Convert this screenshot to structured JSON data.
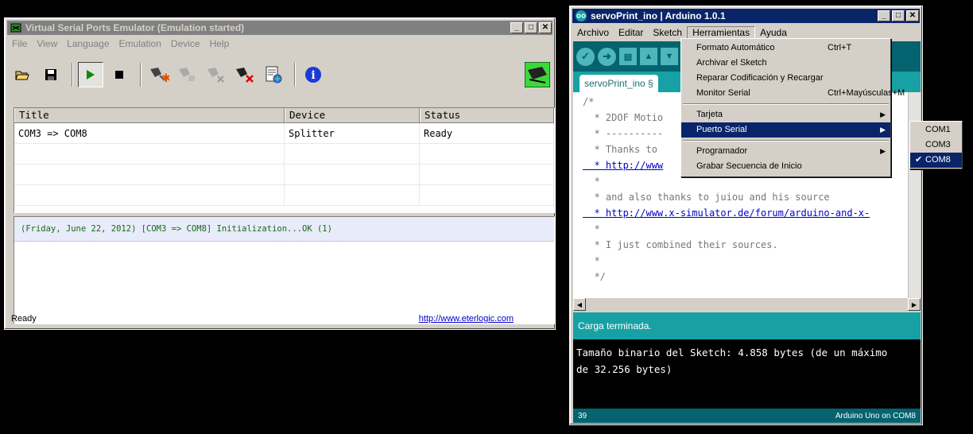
{
  "vspe": {
    "title": "Virtual Serial Ports Emulator (Emulation started)",
    "menu": [
      "File",
      "View",
      "Language",
      "Emulation",
      "Device",
      "Help"
    ],
    "table": {
      "headers": [
        "Title",
        "Device",
        "Status"
      ],
      "rows": [
        [
          "COM3 => COM8",
          "Splitter",
          "Ready"
        ]
      ]
    },
    "log": [
      "(Friday, June 22, 2012) [COM3 => COM8] Initialization...OK (1)"
    ],
    "status_text": "Ready",
    "status_link": "http://www.eterlogic.com"
  },
  "arduino": {
    "title": "servoPrint_ino | Arduino 1.0.1",
    "menu": [
      "Archivo",
      "Editar",
      "Sketch",
      "Herramientas",
      "Ayuda"
    ],
    "tab_label": "servoPrint_ino §",
    "code_lines": [
      "/*",
      "  * 2DOF Motio",
      "  * ----------",
      "  * Thanks to",
      "  * http://www",
      "  *",
      "  * and also thanks to juiou and his source",
      "  * http://www.x-simulator.de/forum/arduino-and-x-",
      "  *",
      "  * I just combined their sources.",
      "  *",
      "  */"
    ],
    "status_message": "Carga terminada.",
    "console": [
      "Tamaño binario del Sketch: 4.858 bytes (de un máximo",
      "de 32.256 bytes)"
    ],
    "line_number": "39",
    "board": "Arduino Uno on COM8"
  },
  "tools_menu": {
    "items": [
      {
        "label": "Formato Automático",
        "shortcut": "Ctrl+T"
      },
      {
        "label": "Archivar el Sketch",
        "shortcut": ""
      },
      {
        "label": "Reparar Codificación y Recargar",
        "shortcut": ""
      },
      {
        "label": "Monitor Serial",
        "shortcut": "Ctrl+Mayúsculas+M"
      },
      {
        "label": "Tarjeta",
        "shortcut": ""
      },
      {
        "label": "Puerto Serial",
        "shortcut": ""
      },
      {
        "label": "Programador",
        "shortcut": ""
      },
      {
        "label": "Grabar Secuencia de Inicio",
        "shortcut": ""
      }
    ]
  },
  "port_menu": {
    "items": [
      "COM1",
      "COM3",
      "COM8"
    ],
    "selected": "COM8",
    "check": "✔"
  },
  "colors": {
    "arduino_dark": "#04636e",
    "arduino_teal": "#17a1a5",
    "menu_highlight": "#0a246a"
  }
}
